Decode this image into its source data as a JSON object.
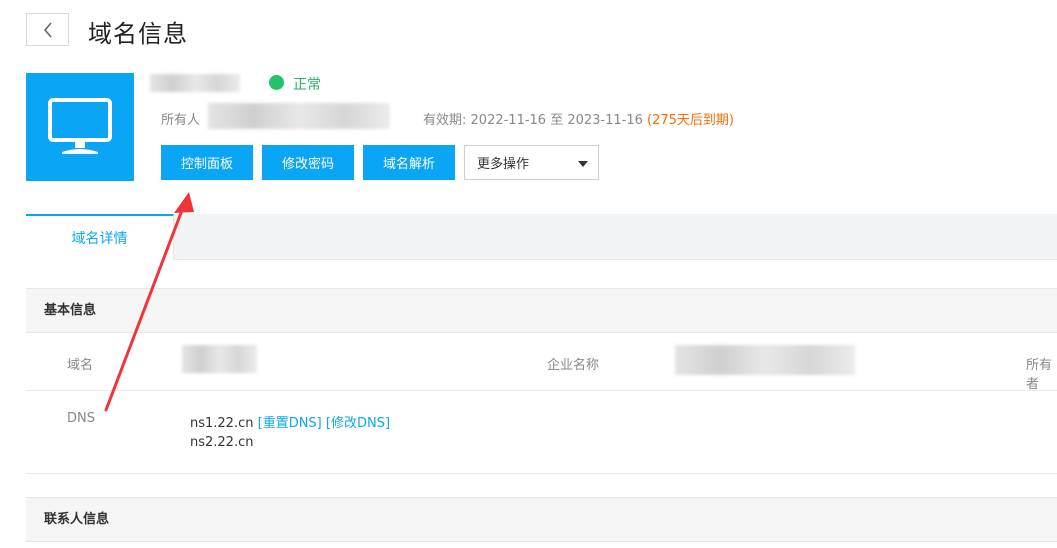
{
  "header": {
    "title": "域名信息",
    "back_icon": "chevron-left-icon"
  },
  "domain": {
    "status": "正常",
    "owner_label": "所有人",
    "validity_label": "有效期:",
    "validity_range": "2022-11-16 至 2023-11-16",
    "validity_remaining": "(275天后到期)",
    "monitor_icon": "monitor-icon",
    "colors": {
      "accent": "#0aa6f5",
      "status_ok": "#23c36a",
      "warning": "#ff6a00"
    }
  },
  "actions": {
    "control_panel": "控制面板",
    "change_password": "修改密码",
    "dns_resolve": "域名解析",
    "more_ops": "更多操作"
  },
  "tabs": [
    {
      "label": "域名详情",
      "active": true
    }
  ],
  "basic_info": {
    "section_title": "基本信息",
    "domain_label": "域名",
    "company_label": "企业名称",
    "owner_label_truncated": "所有者",
    "dns_label": "DNS",
    "dns_servers": [
      "ns1.22.cn",
      "ns2.22.cn"
    ],
    "reset_dns": "[重置DNS]",
    "modify_dns": "[修改DNS]"
  },
  "contact_info": {
    "section_title": "联系人信息"
  }
}
